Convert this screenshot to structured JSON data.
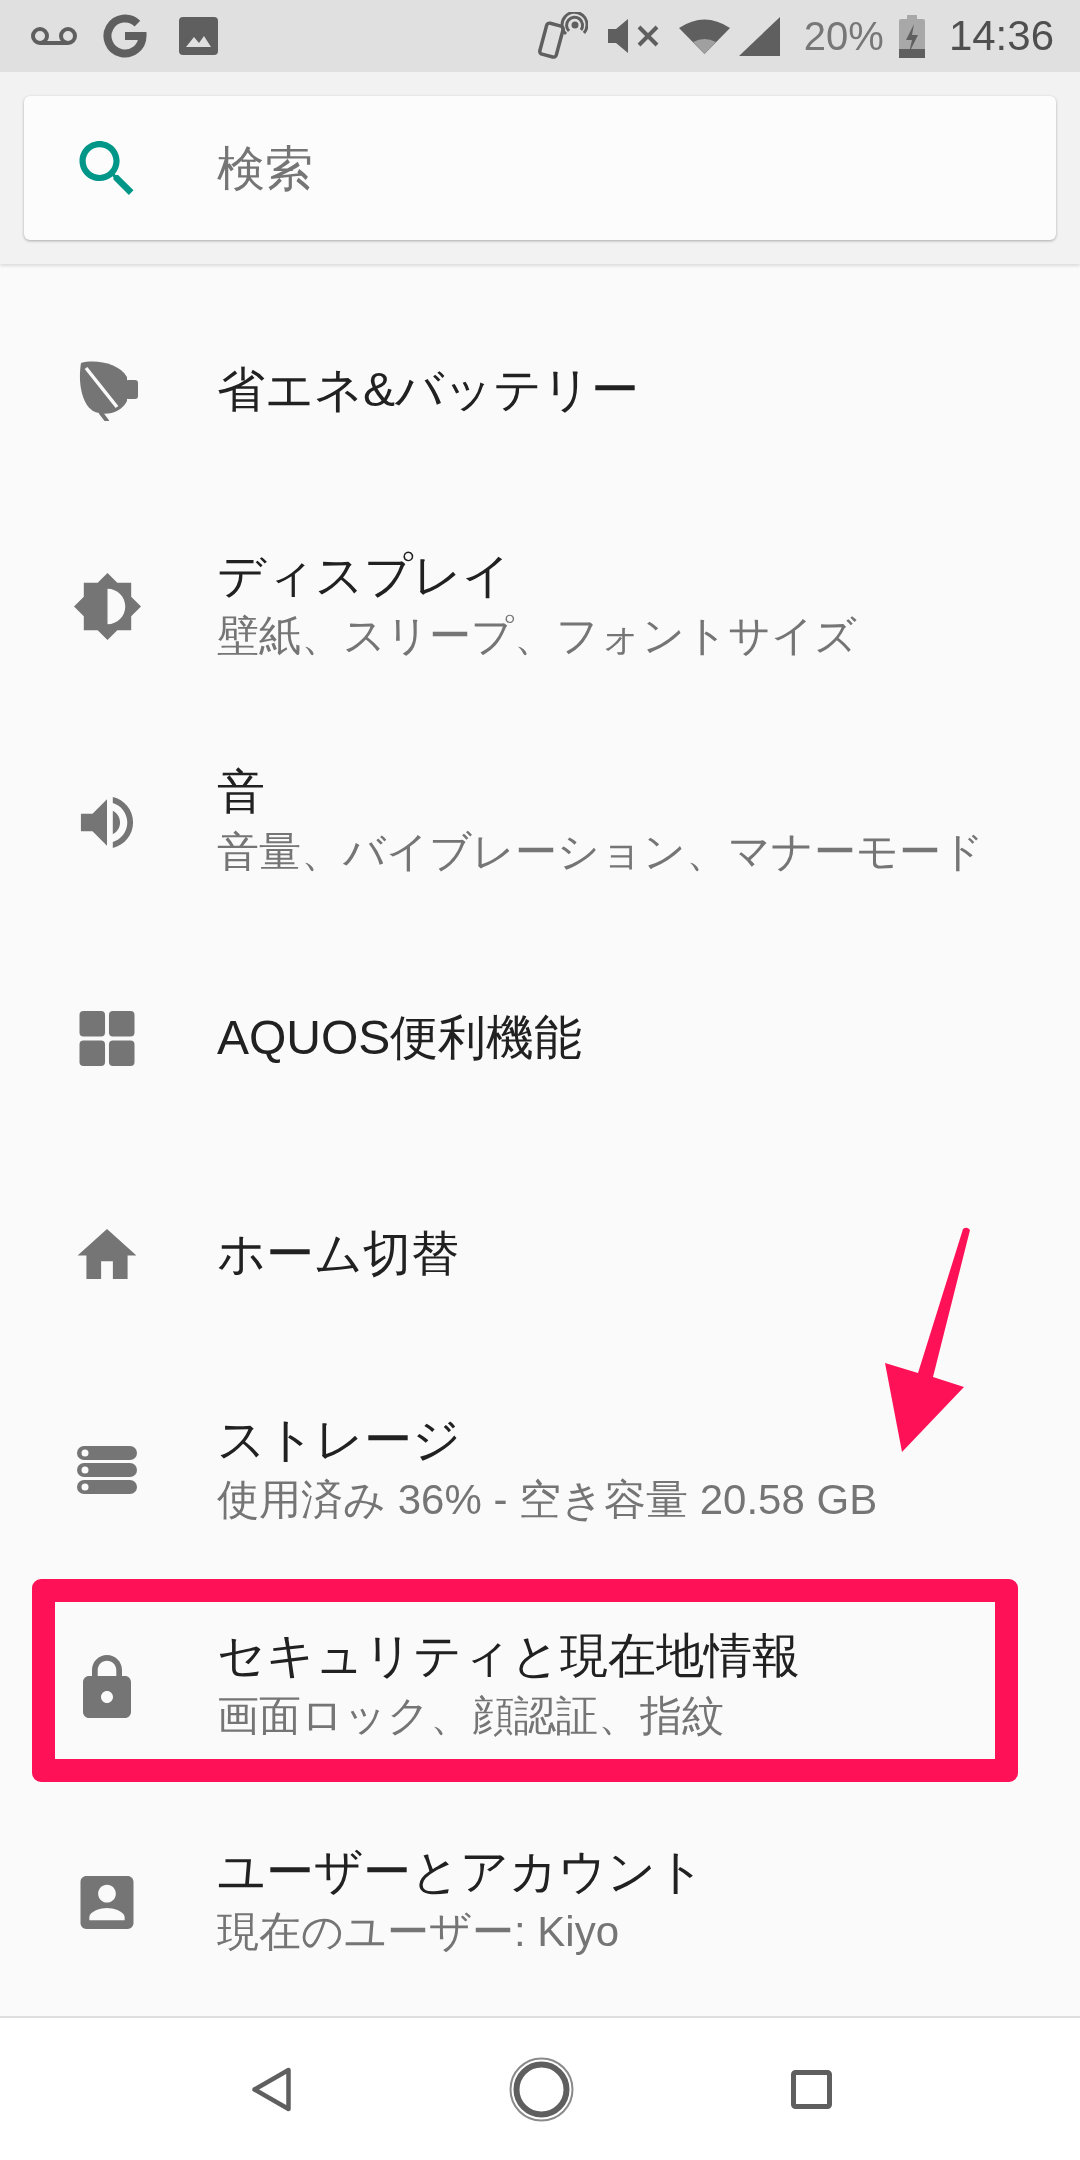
{
  "status_bar": {
    "battery": "20%",
    "time": "14:36"
  },
  "search": {
    "placeholder": "検索"
  },
  "settings": [
    {
      "title": "省エネ&バッテリー",
      "highlighted": false
    },
    {
      "title": "ディスプレイ",
      "summary": "壁紙、スリープ、フォントサイズ",
      "highlighted": false
    },
    {
      "title": "音",
      "summary": "音量、バイブレーション、マナーモード",
      "highlighted": false
    },
    {
      "title": "AQUOS便利機能",
      "highlighted": false
    },
    {
      "title": "ホーム切替",
      "highlighted": false
    },
    {
      "title": "ストレージ",
      "summary": "使用済み 36% - 空き容量 20.58 GB",
      "highlighted": false
    },
    {
      "title": "セキュリティと現在地情報",
      "summary": "画面ロック、顔認証、指紋",
      "highlighted": true
    },
    {
      "title": "ユーザーとアカウント",
      "summary": "現在のユーザー: Kiyo",
      "highlighted": false
    }
  ]
}
